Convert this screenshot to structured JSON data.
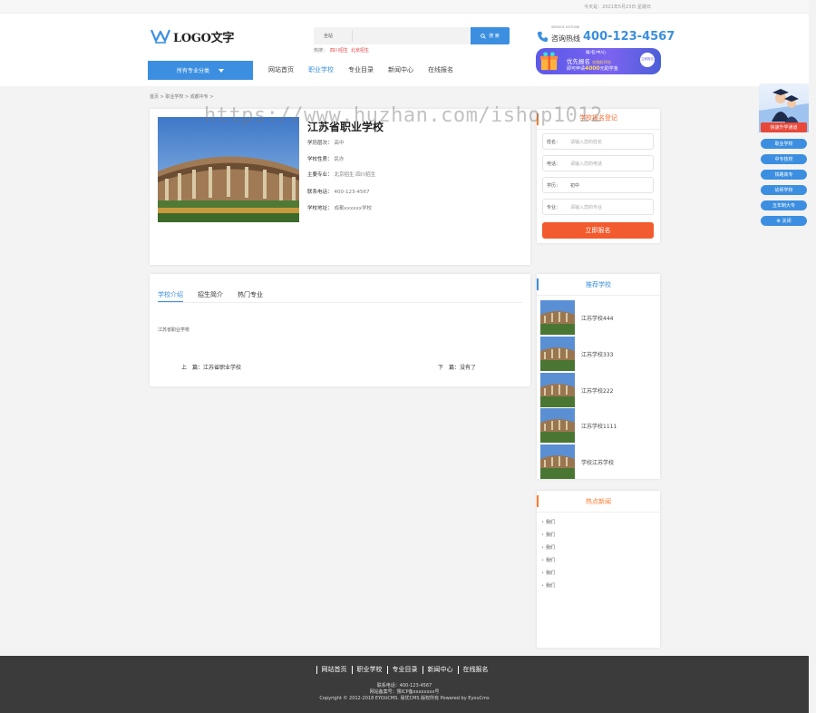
{
  "topbar": {
    "date": "今天是：2021年5月23日 星期日"
  },
  "header": {
    "logo_text": "LOGO文字",
    "search": {
      "scope": "全站",
      "placeholder": "",
      "button": "搜 索"
    },
    "hot": {
      "label": "热搜：",
      "items": [
        "四川招生",
        "北京招生"
      ]
    },
    "phone": {
      "label": "咨询热线",
      "number": "400-123-4567",
      "small_en": "SERVICE HOTLINE"
    },
    "banner": {
      "line1": "报/名/中/心",
      "line2": "优先报名",
      "line2_small": "仅限前30名",
      "line3_pre": "即可申请",
      "line3_amount": "4000",
      "line3_post": "元助学金",
      "seal": "立即报名"
    },
    "category_button": "所有专业分类",
    "nav": [
      "网站首页",
      "职业学校",
      "专业目录",
      "新闻中心",
      "在线报名"
    ],
    "nav_active_index": 1
  },
  "breadcrumb": "首页 > 职业学校 > 成都中专 >",
  "school": {
    "name": "江苏省职业学校",
    "info": [
      {
        "label": "学历层次：",
        "value": "高中"
      },
      {
        "label": "学校性质：",
        "value": "民办"
      },
      {
        "label": "主要专业：",
        "value": "北京招生 四川招生"
      },
      {
        "label": "联系电话：",
        "value": "400-123-4567"
      },
      {
        "label": "学校地址：",
        "value": "成都xxxxxx学校"
      }
    ]
  },
  "enroll": {
    "title": "学校报名登记",
    "fields": [
      {
        "label": "姓名：",
        "placeholder": "请输入您的姓名"
      },
      {
        "label": "电话：",
        "placeholder": "请输入您的电话"
      },
      {
        "label": "学历：",
        "value": "初中"
      },
      {
        "label": "专业：",
        "placeholder": "请输入您的专业"
      }
    ],
    "submit": "立即报名"
  },
  "tabs": {
    "items": [
      "学校介绍",
      "招生简介",
      "热门专业"
    ],
    "active_index": 0,
    "content": "江苏省职业学校",
    "prev": "上　篇：江苏省职业学校",
    "next": "下　篇：没有了"
  },
  "recommend": {
    "title": "推荐学校",
    "items": [
      "江苏学校444",
      "江苏学校333",
      "江苏学校222",
      "江苏学校1111",
      "学校江苏学校"
    ]
  },
  "news": {
    "title": "热点新闻",
    "items": [
      "我们",
      "我们",
      "我们",
      "我们",
      "我们",
      "我们"
    ]
  },
  "float_side": {
    "label": "快速升学通道",
    "buttons": [
      "职业学校",
      "中专技校",
      "铁路高专",
      "幼师学校",
      "五年制大专",
      "关闭"
    ]
  },
  "watermark": "https://www.huzhan.com/ishop1012",
  "footer": {
    "nav": [
      "网站首页",
      "职业学校",
      "专业目录",
      "新闻中心",
      "在线报名"
    ],
    "line1": "联系电话：400-123-4567",
    "line2": "网站备案号：豫ICP备xxxxxxxx号",
    "line3": "Copyright © 2012-2018 EYOUCMS. 易优CMS 版权所有 Powered by EyouCms"
  },
  "colors": {
    "primary": "#3c8fe0",
    "accent": "#f25b2e",
    "footer_bg": "#3b3b3b"
  }
}
